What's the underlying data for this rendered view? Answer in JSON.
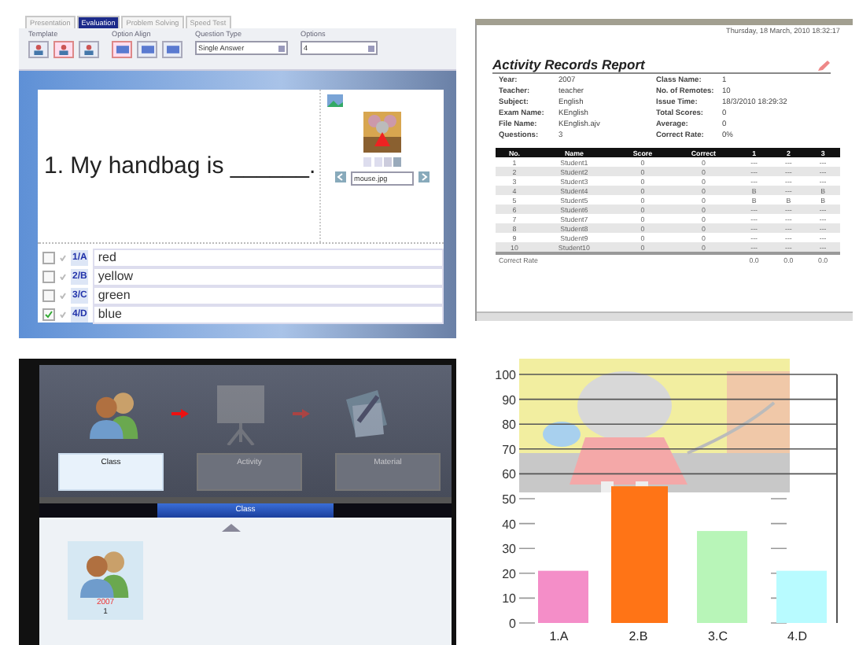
{
  "editor": {
    "tabs": [
      {
        "label": "Presentation",
        "selected": false
      },
      {
        "label": "Evaluation",
        "selected": true
      },
      {
        "label": "Problem Solving",
        "selected": false
      },
      {
        "label": "Speed Test",
        "selected": false
      }
    ],
    "template_label": "Template",
    "align_label": "Option Align",
    "template_buttons": [
      {
        "selected": false
      },
      {
        "selected": true
      },
      {
        "selected": false
      }
    ],
    "align_buttons": [
      {
        "selected": true
      },
      {
        "selected": false
      },
      {
        "selected": false
      }
    ],
    "question_type": {
      "label": "Question Type",
      "value": "Single Answer"
    },
    "options": {
      "label": "Options",
      "value": "4"
    },
    "question": "1. My handbag is ______.",
    "image_file": "mouse.jpg",
    "answers": [
      {
        "key": "1/A",
        "text": "red",
        "checked": false
      },
      {
        "key": "2/B",
        "text": "yellow",
        "checked": false
      },
      {
        "key": "3/C",
        "text": "green",
        "checked": false
      },
      {
        "key": "4/D",
        "text": "blue",
        "checked": true
      }
    ]
  },
  "report": {
    "timestamp": "Thursday, 18 March, 2010 18:32:17",
    "title": "Activity Records Report",
    "fields": [
      {
        "label": "Year:",
        "value": "2007"
      },
      {
        "label": "Class Name:",
        "value": "1"
      },
      {
        "label": "Teacher:",
        "value": "teacher"
      },
      {
        "label": "No. of Remotes:",
        "value": "10"
      },
      {
        "label": "Subject:",
        "value": "English"
      },
      {
        "label": "Issue Time:",
        "value": "18/3/2010 18:29:32"
      },
      {
        "label": "Exam Name:",
        "value": "KEnglish"
      },
      {
        "label": "Total Scores:",
        "value": "0"
      },
      {
        "label": "File Name:",
        "value": "KEnglish.ajv"
      },
      {
        "label": "Average:",
        "value": "0"
      },
      {
        "label": "Questions:",
        "value": "3"
      },
      {
        "label": "Correct Rate:",
        "value": "0%"
      }
    ],
    "table": {
      "columns": [
        "No.",
        "Name",
        "Score",
        "Correct",
        "1",
        "2",
        "3"
      ],
      "rows": [
        [
          "1",
          "Student1",
          "0",
          "0",
          "---",
          "---",
          "---"
        ],
        [
          "2",
          "Student2",
          "0",
          "0",
          "---",
          "---",
          "---"
        ],
        [
          "3",
          "Student3",
          "0",
          "0",
          "---",
          "---",
          "---"
        ],
        [
          "4",
          "Student4",
          "0",
          "0",
          "B",
          "---",
          "B"
        ],
        [
          "5",
          "Student5",
          "0",
          "0",
          "B",
          "B",
          "B"
        ],
        [
          "6",
          "Student6",
          "0",
          "0",
          "---",
          "---",
          "---"
        ],
        [
          "7",
          "Student7",
          "0",
          "0",
          "---",
          "---",
          "---"
        ],
        [
          "8",
          "Student8",
          "0",
          "0",
          "---",
          "---",
          "---"
        ],
        [
          "9",
          "Student9",
          "0",
          "0",
          "---",
          "---",
          "---"
        ],
        [
          "10",
          "Student10",
          "0",
          "0",
          "---",
          "---",
          "---"
        ]
      ],
      "footer": [
        "Correct Rate",
        "0.0",
        "0.0",
        "0.0"
      ]
    }
  },
  "class_panel": {
    "steps": [
      {
        "label": "Class",
        "selected": true
      },
      {
        "label": "Activity",
        "selected": false
      },
      {
        "label": "Material",
        "selected": false
      }
    ],
    "section_title": "Class",
    "cards": [
      {
        "year": "2007",
        "name": "1"
      }
    ]
  },
  "chart_panel": {
    "chart_data": {
      "type": "bar",
      "categories": [
        "1.A",
        "2.B",
        "3.C",
        "4.D"
      ],
      "values": [
        21,
        55,
        37,
        21
      ],
      "grid": true,
      "ylim": [
        0,
        100
      ],
      "yticks": [
        0,
        10,
        20,
        30,
        40,
        50,
        60,
        70,
        80,
        90,
        100
      ]
    }
  }
}
